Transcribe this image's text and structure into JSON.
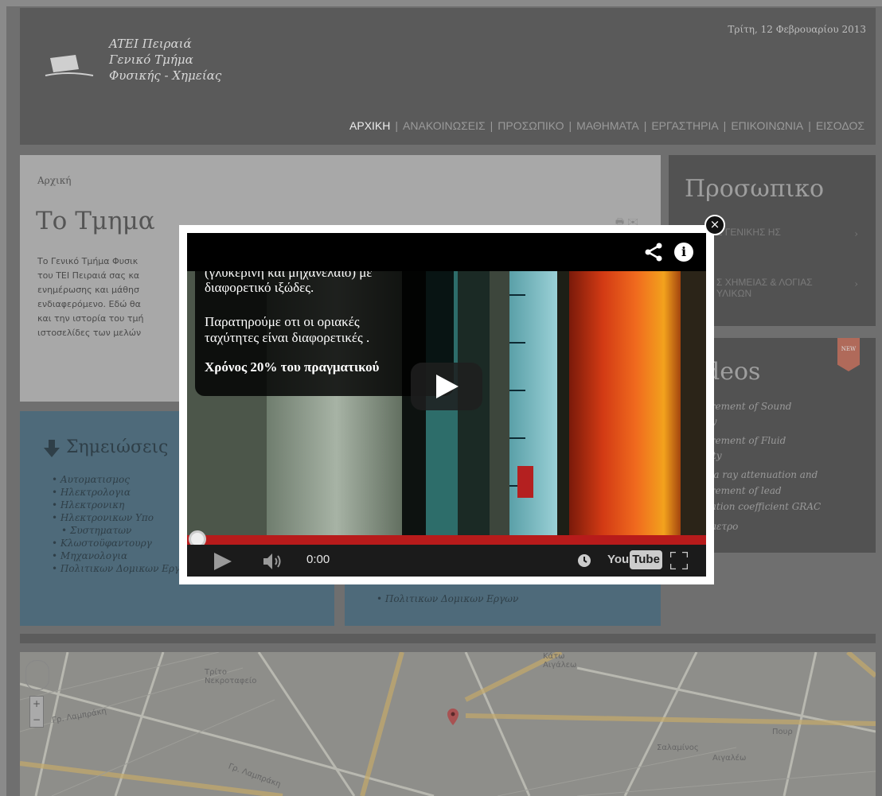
{
  "header": {
    "logo_lines": [
      "ATEI Πειραιά",
      "Γενικό Τμήμα",
      "Φυσικής - Χημείας"
    ],
    "date": "Τρίτη, 12 Φεβρουαρίου 2013",
    "nav": [
      "ΑΡΧΙΚΗ",
      "ΑΝΑΚΟΙΝΩΣΕΙΣ",
      "ΠΡΟΣΩΠΙΚΟ",
      "ΜΑΘΗΜΑΤΑ",
      "ΕΡΓΑΣΤΗΡΙΑ",
      "ΕΠΙΚΟΙΝΩΝΙΑ",
      "ΕΙΣΟΔΟΣ"
    ],
    "nav_sep": "|"
  },
  "main": {
    "breadcrumb": "Αρχική",
    "title": "Το Τμημα",
    "print_icons": "🖶 ✉",
    "intro_lines": [
      "Το Γενικό Τμήμα Φυσικ",
      "του ΤΕΙ Πειραιά σας κα",
      "ενημέρωσης και μάθησ",
      "ενδιαφερόμενο. Εδώ θα",
      "και την ιστορία του τμή",
      "ιστοσελίδες των μελών"
    ]
  },
  "sidebar": {
    "title": "Προσωπικο",
    "links": [
      "Σ ΓΕΝΙΚΗΣ ΗΣ",
      "Σ ΧΗΜΕΙΑΣ & ΛΟΓΙΑΣ ΥΛΙΚΩΝ"
    ],
    "chevron": "›"
  },
  "videos": {
    "title": "deos",
    "badge": "NEW",
    "links": [
      "urement of Sound",
      "ity",
      "urement of Fluid",
      "sity",
      "ma ray attenuation and",
      "urement of lead",
      "uation coefficient GRAC",
      "ομετρο"
    ]
  },
  "notes": {
    "title": "Σημειώσεις",
    "items": [
      "Αυτοματισμος",
      "Ηλεκτρολογια",
      "Ηλεκτρονικη",
      "Ηλεκτρονικων Υπο",
      "Συστηματων",
      "Κλωστοϋφαντουργ",
      "Μηχανολογια",
      "Πολιτικων Δομικων Εργων"
    ],
    "items2": [
      "Πολιτικων Δομικων Εργων"
    ]
  },
  "map": {
    "labels": [
      "Τρίτο Νεκροταφείο",
      "Γρ. Λαμπράκη",
      "Πουρ",
      "Κάτω Αιγάλεω",
      "Γρ. Λαμπράκη",
      "Σαλαμίνος",
      "Αιγαλέω"
    ],
    "zoom_in": "+",
    "zoom_out": "−"
  },
  "lightbox": {
    "close": "×",
    "subtitle_lines": [
      "(γλυκερίνη και μηχανέλαιο) με",
      "διαφορετικό ιξώδες.",
      "Παρατηρούμε οτι οι οριακές",
      "ταχύτητες είναι διαφορετικές .",
      "Χρόνος 20% του πραγματικού"
    ],
    "info": "i",
    "time": "0:00",
    "yt_you": "You",
    "yt_tube": "Tube",
    "progress_fraction": 0.0
  },
  "colors": {
    "progress": "#b71b1b",
    "overlay": "#6f6f6f"
  }
}
